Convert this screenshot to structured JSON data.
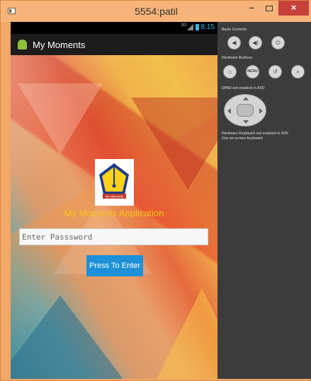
{
  "window": {
    "title": "5554:patil",
    "minimize_label": "–",
    "close_label": "×"
  },
  "statusbar": {
    "network": "3G",
    "time": "8:15"
  },
  "app": {
    "title": "My Moments",
    "heading": "My Moments Application",
    "logo_text": "My Moments",
    "password_placeholder": "Enter Passsword",
    "enter_button": "Press To Enter"
  },
  "controls": {
    "basic_title": "Basic Controls",
    "hardware_title": "Hardware Buttons",
    "menu_label": "MENU",
    "dpad_text": "DPAD not enabled in AVD",
    "keyboard_line1": "Hardware Keyboard not enabled in AVD",
    "keyboard_line2": "Use on screen keyboard"
  },
  "colors": {
    "window_accent": "#f6b47a",
    "button": "#1e90d9",
    "heading": "#f5c518",
    "close": "#c7403a"
  }
}
